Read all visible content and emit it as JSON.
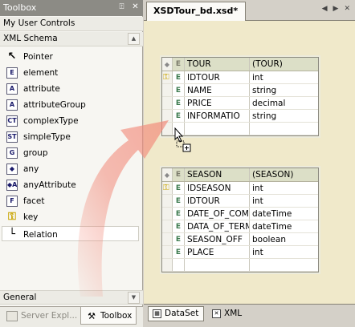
{
  "toolbox": {
    "title": "Toolbox",
    "pin_glyph": "⍐",
    "close_glyph": "✕",
    "groups": {
      "user_controls": "My User Controls",
      "xml_schema": "XML Schema",
      "general": "General"
    },
    "items": [
      {
        "label": "Pointer",
        "icon": "pointer-icon",
        "glyph": "↖"
      },
      {
        "label": "element",
        "icon": "element-icon",
        "glyph": "E"
      },
      {
        "label": "attribute",
        "icon": "attribute-icon",
        "glyph": "A"
      },
      {
        "label": "attributeGroup",
        "icon": "attribute-group-icon",
        "glyph": "A"
      },
      {
        "label": "complexType",
        "icon": "complex-type-icon",
        "glyph": "CT"
      },
      {
        "label": "simpleType",
        "icon": "simple-type-icon",
        "glyph": "ST"
      },
      {
        "label": "group",
        "icon": "group-icon",
        "glyph": "G"
      },
      {
        "label": "any",
        "icon": "any-icon",
        "glyph": "◆"
      },
      {
        "label": "anyAttribute",
        "icon": "any-attribute-icon",
        "glyph": "◆A"
      },
      {
        "label": "facet",
        "icon": "facet-icon",
        "glyph": "F"
      },
      {
        "label": "key",
        "icon": "key-icon",
        "glyph": "⚿"
      },
      {
        "label": "Relation",
        "icon": "relation-icon",
        "glyph": "└"
      }
    ],
    "selected_item": "Relation",
    "bottom_tabs": {
      "server_explorer": "Server Expl...",
      "toolbox": "Toolbox"
    }
  },
  "document": {
    "tab_title": "XSDTour_bd.xsd*",
    "controls": [
      "◀",
      "▶",
      "✕"
    ]
  },
  "tables": {
    "tour": {
      "name": "TOUR",
      "type": "(TOUR)",
      "rows": [
        {
          "key": true,
          "kind": "E",
          "name": "IDTOUR",
          "dtype": "int"
        },
        {
          "key": false,
          "kind": "E",
          "name": "NAME",
          "dtype": "string"
        },
        {
          "key": false,
          "kind": "E",
          "name": "PRICE",
          "dtype": "decimal"
        },
        {
          "key": false,
          "kind": "E",
          "name": "INFORMATIO",
          "dtype": "string"
        }
      ]
    },
    "season": {
      "name": "SEASON",
      "type": "(SEASON)",
      "rows": [
        {
          "key": true,
          "kind": "E",
          "name": "IDSEASON",
          "dtype": "int"
        },
        {
          "key": false,
          "kind": "E",
          "name": "IDTOUR",
          "dtype": "int"
        },
        {
          "key": false,
          "kind": "E",
          "name": "DATE_OF_COMM",
          "dtype": "dateTime"
        },
        {
          "key": false,
          "kind": "E",
          "name": "DATA_OF_TERMI",
          "dtype": "dateTime"
        },
        {
          "key": false,
          "kind": "E",
          "name": "SEASON_OFF",
          "dtype": "boolean"
        },
        {
          "key": false,
          "kind": "E",
          "name": "PLACE",
          "dtype": "int"
        }
      ]
    }
  },
  "view_tabs": {
    "dataset": "DataSet",
    "xml": "XML"
  },
  "colors": {
    "drag_arrow": "#f28a7a",
    "designer_bg": "#f0e9ca",
    "table_header": "#dcdfc7"
  }
}
